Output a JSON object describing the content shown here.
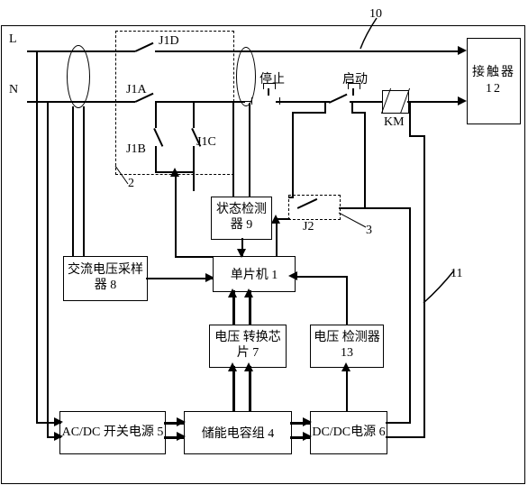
{
  "terminals": {
    "L": "L",
    "N": "N"
  },
  "relays": {
    "J1D": "J1D",
    "J1A": "J1A",
    "J1B": "J1B",
    "J1C": "J1C",
    "J2": "J2"
  },
  "buttons": {
    "stop": "停止",
    "start": "启动"
  },
  "coil": {
    "KM": "KM"
  },
  "callouts": {
    "two": "2",
    "three": "3",
    "ten": "10",
    "eleven": "11"
  },
  "blocks": {
    "contactor": "接触器 12",
    "state_detector": "状态检测器 9",
    "ac_voltage_sampler": "交流电压采样器 8",
    "mcu": "单片机 1",
    "voltage_conv_chip": "电压 转换芯片 7",
    "voltage_detector": "电压 检测器 13",
    "acdc_ps": "AC/DC 开关电源 5",
    "cap_bank": "储能电容组 4",
    "dcdc_ps": "DC/DC电源 6"
  }
}
